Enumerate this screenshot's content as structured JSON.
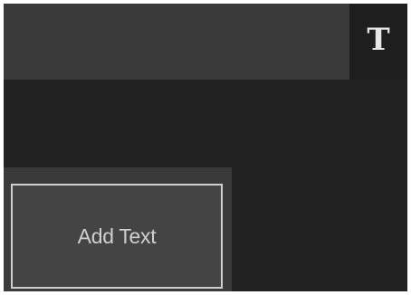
{
  "toolbar": {
    "text_tool_icon": "serif-T-text-icon",
    "text_tool_glyph": "T"
  },
  "panel": {
    "add_text_label": "Add Text"
  },
  "colors": {
    "background": "#212121",
    "bar": "#3a3a3a",
    "button_border": "#cfcfcf",
    "text": "#cfcfcf"
  }
}
